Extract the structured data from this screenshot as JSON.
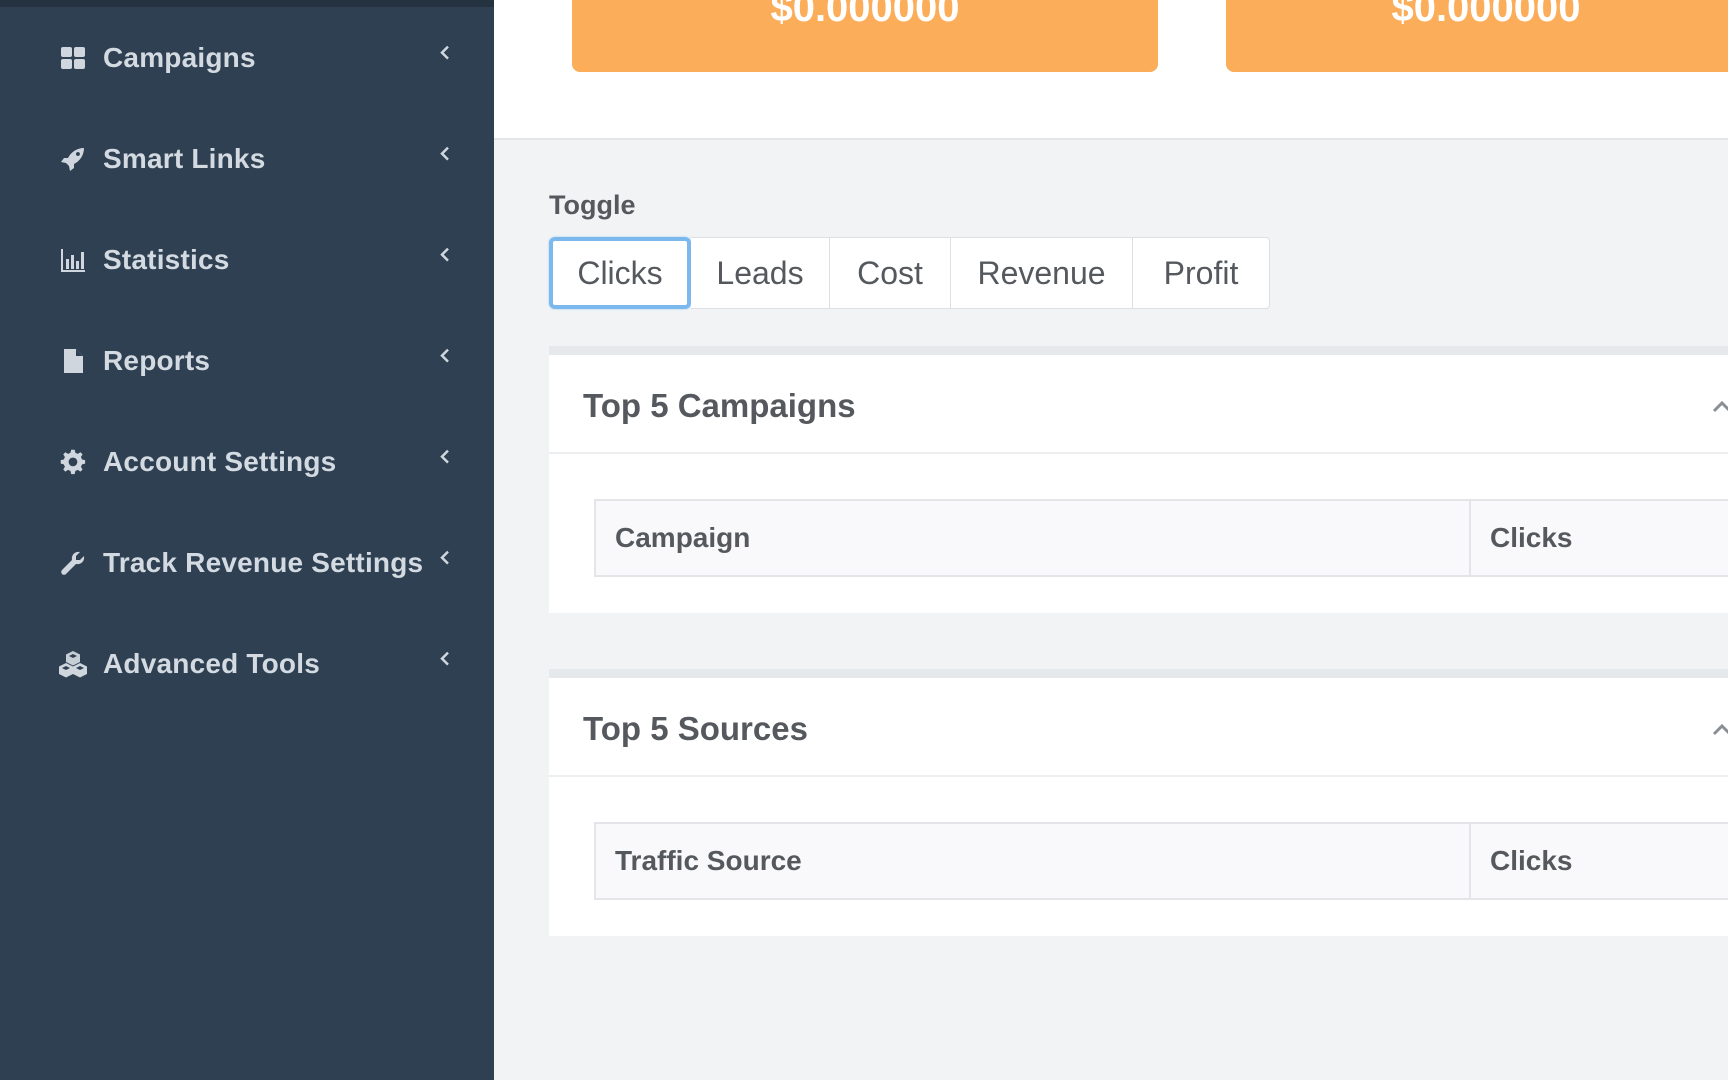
{
  "sidebar": {
    "items": [
      {
        "label": "Campaigns",
        "icon": "grid-icon"
      },
      {
        "label": "Smart Links",
        "icon": "rocket-icon"
      },
      {
        "label": "Statistics",
        "icon": "bar-chart-icon"
      },
      {
        "label": "Reports",
        "icon": "document-icon"
      },
      {
        "label": "Account Settings",
        "icon": "gear-icon"
      },
      {
        "label": "Track Revenue Settings",
        "icon": "wrench-icon"
      },
      {
        "label": "Advanced Tools",
        "icon": "cubes-icon"
      }
    ]
  },
  "stats": {
    "cards": [
      {
        "value": "$0.000000"
      },
      {
        "value": "$0.000000"
      }
    ],
    "accent_color": "#fbad5a"
  },
  "toggle": {
    "label": "Toggle",
    "options": [
      "Clicks",
      "Leads",
      "Cost",
      "Revenue",
      "Profit"
    ],
    "selected": "Clicks",
    "active_border_color": "#7ab8ee"
  },
  "panels": {
    "campaigns": {
      "title": "Top 5 Campaigns",
      "columns": [
        "Campaign",
        "Clicks"
      ]
    },
    "sources": {
      "title": "Top 5 Sources",
      "columns": [
        "Traffic Source",
        "Clicks"
      ]
    }
  }
}
